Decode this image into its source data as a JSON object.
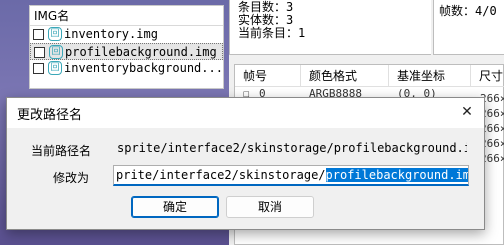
{
  "img_panel": {
    "header": "IMG名",
    "items": [
      {
        "name": "inventory.img",
        "icon": "image-file-icon",
        "icon_glyph": "回"
      },
      {
        "name": "profilebackground.img",
        "icon": "image-file-icon",
        "icon_glyph": "回"
      },
      {
        "name": "inventorybackground...",
        "icon": "image-file-icon",
        "icon_glyph": "回"
      }
    ]
  },
  "info_panel": {
    "lines": [
      "条目数：3",
      "实体数：3",
      "当前条目：1"
    ]
  },
  "frames_panel": {
    "text": "帧数：4/0"
  },
  "frame_table": {
    "columns": [
      "帧号",
      "颜色格式",
      "基准坐标",
      "尺寸"
    ],
    "row": {
      "index": "0",
      "format": "ARGB8888",
      "coord": "(0, 0)"
    }
  },
  "right_fragments": [
    "266×",
    "266×",
    "266×",
    "266×",
    "266×",
    "266×"
  ],
  "dialog": {
    "title": "更改路径名",
    "close": "✕",
    "current_path_label": "当前路径名",
    "current_path_value": "sprite/interface2/skinstorage/profilebackground.im",
    "modify_label": "修改为",
    "modify_prefix": "prite/interface2/skinstorage/",
    "modify_selected": "profilebackground.img",
    "ok_label": "确定",
    "cancel_label": "取消"
  }
}
